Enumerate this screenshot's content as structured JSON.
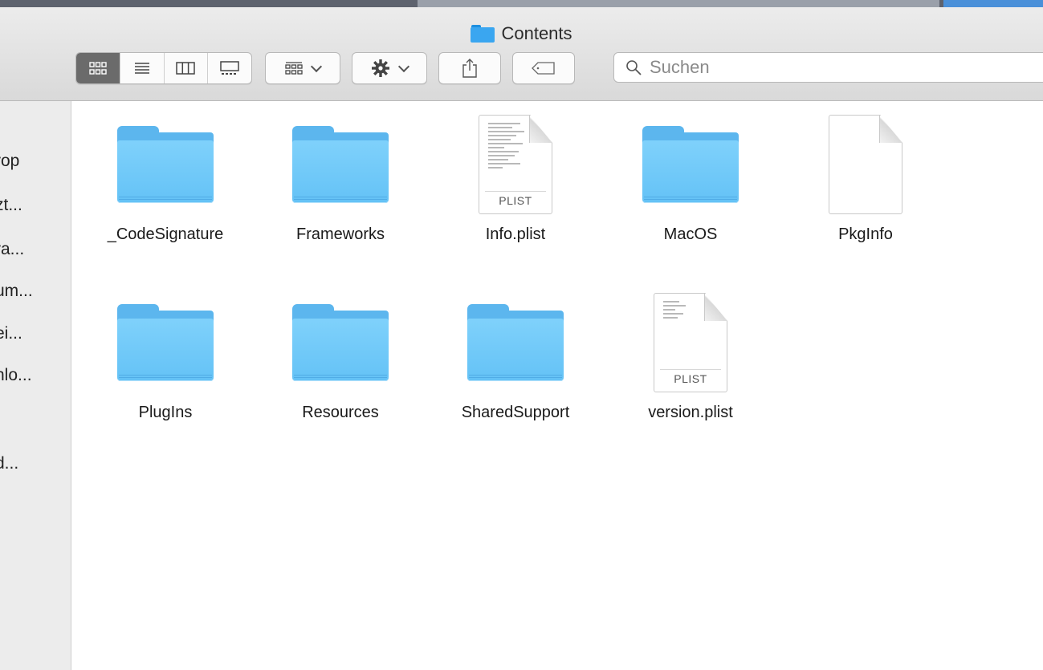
{
  "window": {
    "title": "Contents"
  },
  "toolbar": {
    "view_modes": [
      "icon-view",
      "list-view",
      "column-view",
      "gallery-view"
    ],
    "active_view": "icon-view",
    "search_placeholder": "Suchen"
  },
  "sidebar": {
    "items": [
      {
        "label": "rop"
      },
      {
        "label": "zt..."
      },
      {
        "label": "ra..."
      },
      {
        "label": "um..."
      },
      {
        "label": "ei..."
      },
      {
        "label": "nlo..."
      },
      {
        "label": "d..."
      }
    ]
  },
  "files": [
    {
      "name": "_CodeSignature",
      "kind": "folder"
    },
    {
      "name": "Frameworks",
      "kind": "folder"
    },
    {
      "name": "Info.plist",
      "kind": "plist",
      "badge": "PLIST"
    },
    {
      "name": "MacOS",
      "kind": "folder"
    },
    {
      "name": "PkgInfo",
      "kind": "blank"
    },
    {
      "name": "PlugIns",
      "kind": "folder"
    },
    {
      "name": "Resources",
      "kind": "folder"
    },
    {
      "name": "SharedSupport",
      "kind": "folder"
    },
    {
      "name": "version.plist",
      "kind": "plist",
      "badge": "PLIST"
    }
  ],
  "colors": {
    "folder": "#64c2f6",
    "active_segment": "#6b6b6b",
    "toolbar_bg": "#d9d9d9"
  }
}
